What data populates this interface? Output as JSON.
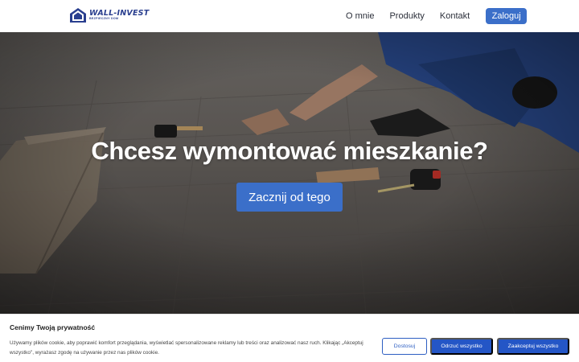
{
  "header": {
    "logo": {
      "name": "WALL-INVEST",
      "tagline": "BEZPIECZNY DOM"
    },
    "nav": [
      {
        "label": "O mnie"
      },
      {
        "label": "Produkty"
      },
      {
        "label": "Kontakt"
      }
    ],
    "login_label": "Zaloguj"
  },
  "hero": {
    "title": "Chcesz wymontować mieszkanie?",
    "cta_label": "Zacznij od tego",
    "image_icon": "floor-installation-photo"
  },
  "cookie": {
    "title": "Cenimy Twoją prywatność",
    "text": "Używamy plików cookie, aby poprawić komfort przeglądania, wyświetlać spersonalizowane reklamy lub treści oraz analizować nasz ruch. Klikając „Akceptuj wszystko\", wyrażasz zgodę na używanie przez nas plików cookie.",
    "customize_label": "Dostosuj",
    "reject_label": "Odrzuć wszystko",
    "accept_label": "Zaakceptuj wszystko"
  },
  "colors": {
    "accent": "#3b6fc9",
    "cookie_button": "#2456c6",
    "logo": "#2a3f8f"
  }
}
